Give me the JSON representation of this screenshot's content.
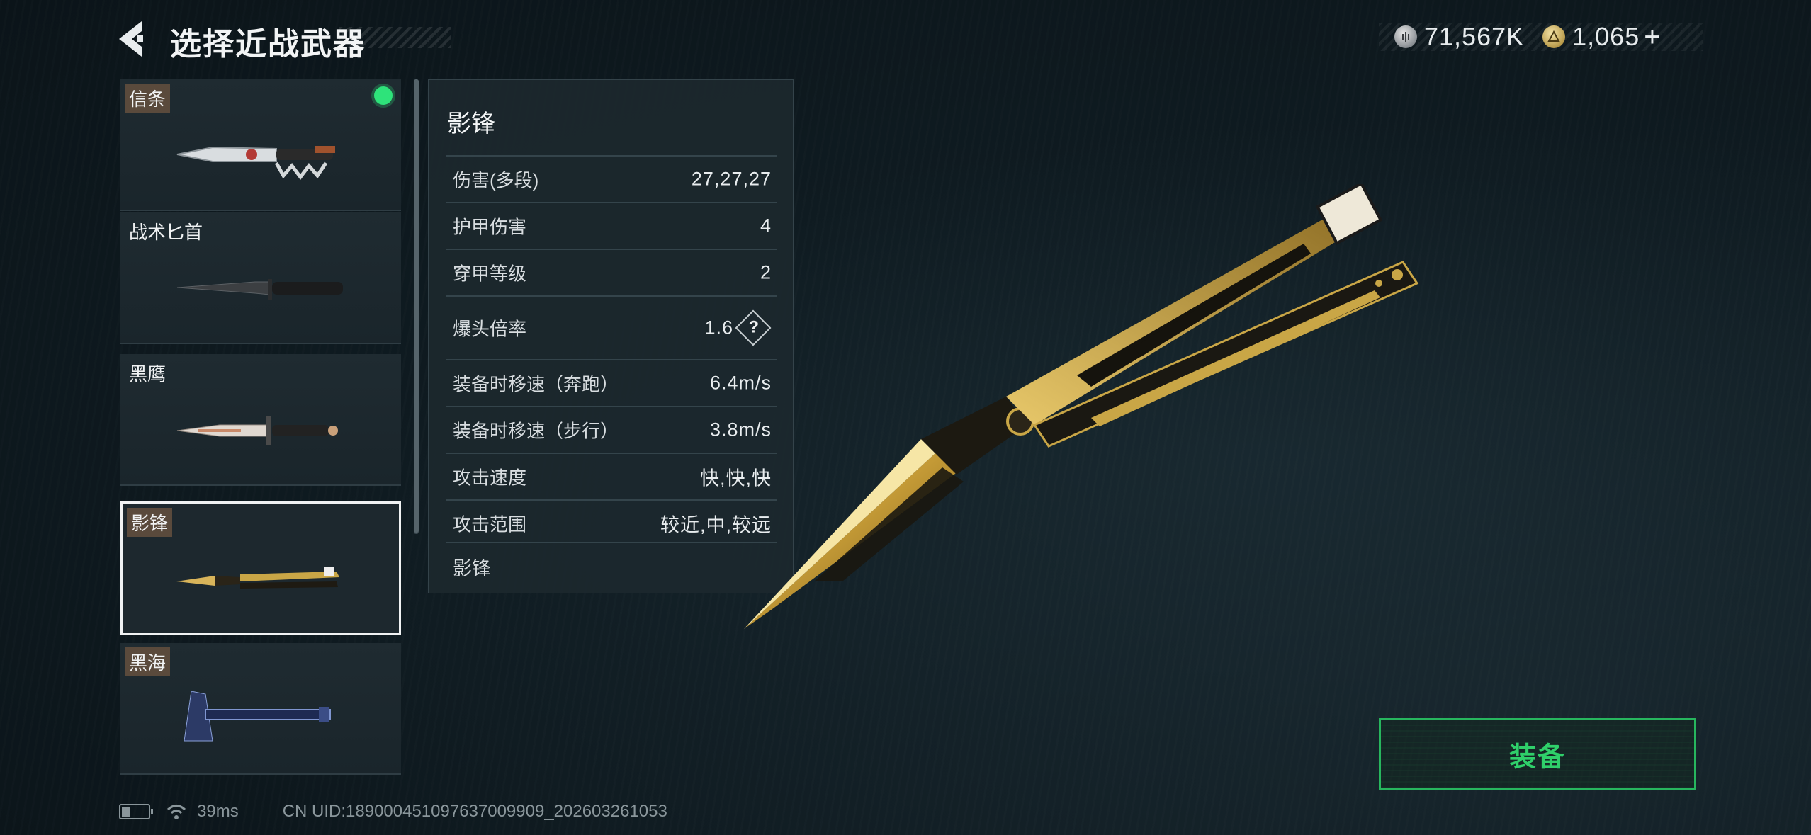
{
  "header": {
    "title": "选择近战武器",
    "back_icon": "back-arrow-icon"
  },
  "currency": {
    "silver": {
      "icon": "silver-coin-icon",
      "value": "71,567K"
    },
    "gold": {
      "icon": "gold-coin-icon",
      "value": "1,065"
    },
    "add_label": "+"
  },
  "weapons": [
    {
      "name": "信条",
      "tagged": true,
      "equipped": true,
      "selected": false
    },
    {
      "name": "战术匕首",
      "tagged": false,
      "equipped": false,
      "selected": false
    },
    {
      "name": "黑鹰",
      "tagged": false,
      "equipped": false,
      "selected": false
    },
    {
      "name": "影锋",
      "tagged": true,
      "equipped": false,
      "selected": true
    },
    {
      "name": "黑海",
      "tagged": true,
      "equipped": false,
      "selected": false
    }
  ],
  "stats": {
    "title": "影锋",
    "rows": [
      {
        "label": "伤害(多段)",
        "value": "27,27,27"
      },
      {
        "label": "护甲伤害",
        "value": "4"
      },
      {
        "label": "穿甲等级",
        "value": "2"
      },
      {
        "label": "爆头倍率",
        "value": "1.6",
        "help": "?"
      },
      {
        "label": "装备时移速（奔跑）",
        "value": "6.4m/s"
      },
      {
        "label": "装备时移速（步行）",
        "value": "3.8m/s"
      },
      {
        "label": "攻击速度",
        "value": "快,快,快"
      },
      {
        "label": "攻击范围",
        "value": "较近,中,较远"
      }
    ],
    "footer": "影锋"
  },
  "equip_button": {
    "label": "装备",
    "color": "#2fd06a"
  },
  "status_bar": {
    "ping": "39ms",
    "uid": "CN UID:18900045109763700​9909_202603261053"
  },
  "colors": {
    "accent_green": "#2ee37a",
    "background": "#0f1b21",
    "gold": "#c9a646"
  }
}
